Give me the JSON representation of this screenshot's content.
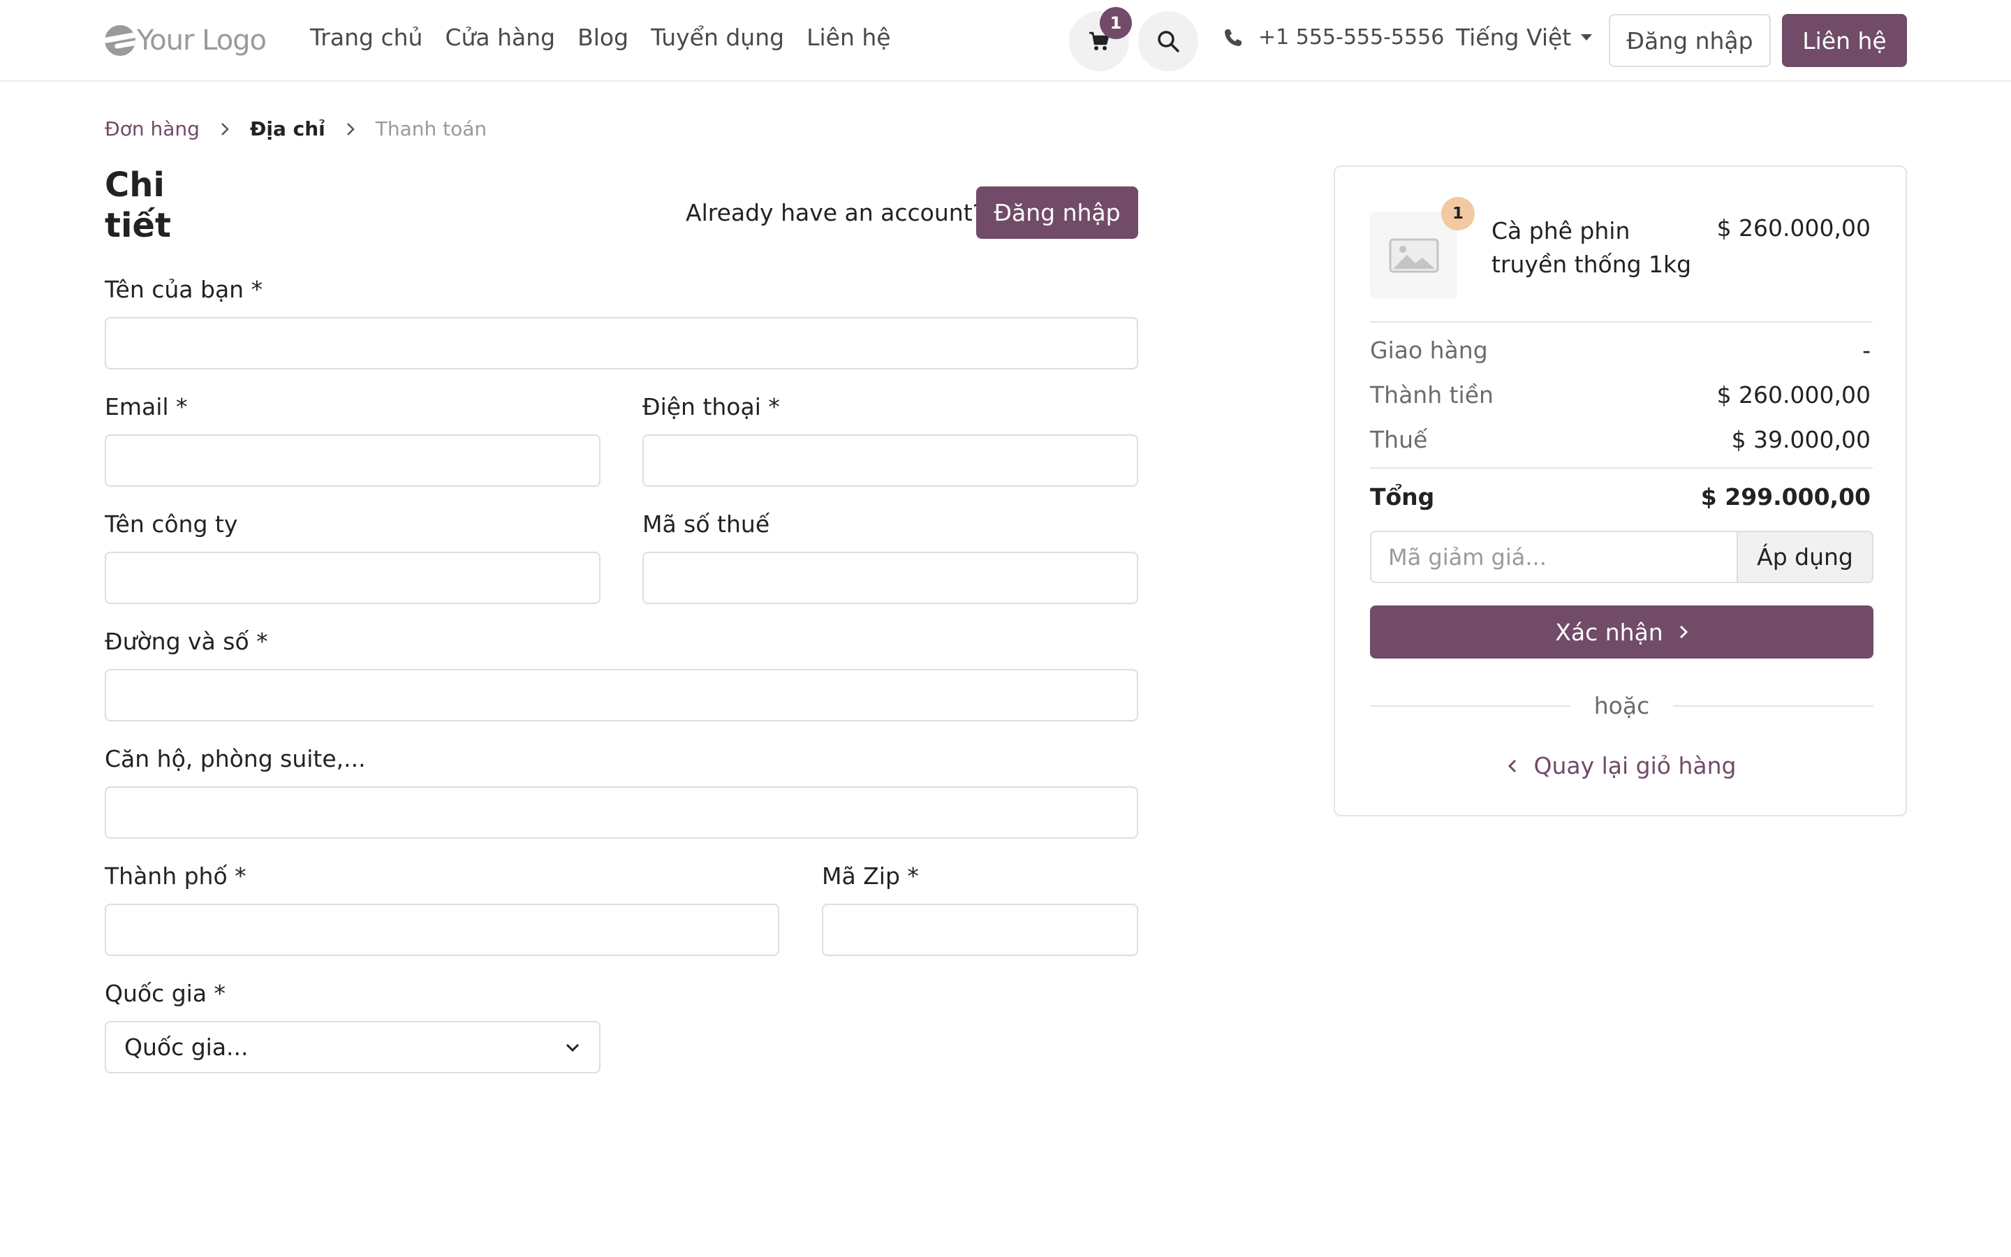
{
  "header": {
    "logo_text": "Your Logo",
    "nav": [
      "Trang chủ",
      "Cửa hàng",
      "Blog",
      "Tuyển dụng",
      "Liên hệ"
    ],
    "cart_count": "1",
    "phone": "+1 555-555-5556",
    "language": "Tiếng Việt",
    "login_label": "Đăng nhập",
    "contact_label": "Liên hệ"
  },
  "breadcrumb": {
    "step1": "Đơn hàng",
    "step2": "Địa chỉ",
    "step3": "Thanh toán"
  },
  "form": {
    "title": "Chi tiết",
    "account_question": "Already have an account?",
    "login_button": "Đăng nhập",
    "name_label": "Tên của bạn *",
    "email_label": "Email *",
    "phone_label": "Điện thoại *",
    "company_label": "Tên công ty",
    "vat_label": "Mã số thuế",
    "street_label": "Đường và số *",
    "street2_label": "Căn hộ, phòng suite,...",
    "city_label": "Thành phố *",
    "zip_label": "Mã Zip *",
    "country_label": "Quốc gia *",
    "country_value": "Quốc gia..."
  },
  "summary": {
    "quantity": "1",
    "product_name": "Cà phê phin truyền thống 1kg",
    "product_price": "$ 260.000,00",
    "delivery_label": "Giao hàng",
    "delivery_value": "-",
    "subtotal_label": "Thành tiền",
    "subtotal_value": "$ 260.000,00",
    "tax_label": "Thuế",
    "tax_value": "$ 39.000,00",
    "total_label": "Tổng",
    "total_value": "$ 299.000,00",
    "coupon_placeholder": "Mã giảm giá...",
    "coupon_button": "Áp dụng",
    "confirm_button": "Xác nhận",
    "or_text": "hoặc",
    "back_link": "Quay lại giỏ hàng"
  },
  "colors": {
    "brand": "#714b67",
    "qty_badge": "#f3c9a1",
    "logo_gray": "#9a9a9a"
  },
  "icons": [
    "cart-icon",
    "search-icon",
    "phone-icon",
    "chevron-right-icon",
    "chevron-left-icon",
    "chevron-down-icon",
    "image-placeholder-icon"
  ]
}
